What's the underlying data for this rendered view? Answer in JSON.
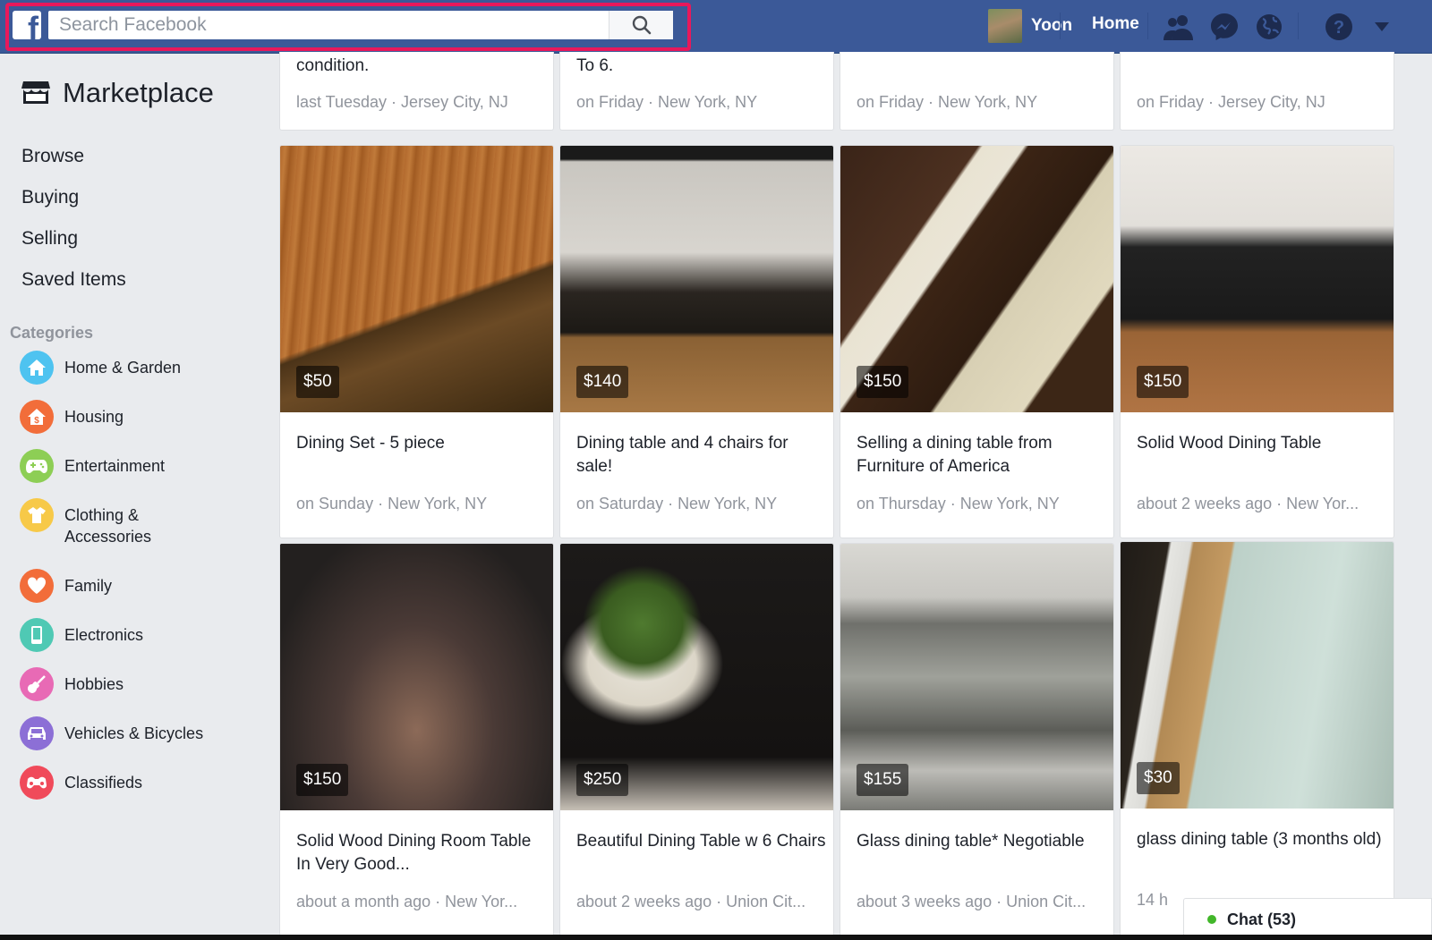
{
  "header": {
    "logo": "f",
    "search_placeholder": "Search Facebook",
    "user_name": "Yoon",
    "home_label": "Home",
    "icons": [
      "friends-icon",
      "messenger-icon",
      "globe-icon",
      "help-icon",
      "caret-down-icon"
    ]
  },
  "sidebar": {
    "title": "Marketplace",
    "nav": [
      "Browse",
      "Buying",
      "Selling",
      "Saved Items"
    ],
    "categories_heading": "Categories",
    "categories": [
      {
        "label": "Home & Garden",
        "icon": "house-icon",
        "color": "#4ec3f0"
      },
      {
        "label": "Housing",
        "icon": "house-dollar-icon",
        "color": "#f26d3a"
      },
      {
        "label": "Entertainment",
        "icon": "gamepad-icon",
        "color": "#8dce55"
      },
      {
        "label": "Clothing & Accessories",
        "icon": "shirt-icon",
        "color": "#f7c948"
      },
      {
        "label": "Family",
        "icon": "heart-icon",
        "color": "#f26d3a"
      },
      {
        "label": "Electronics",
        "icon": "phone-icon",
        "color": "#4fc9b4"
      },
      {
        "label": "Hobbies",
        "icon": "guitar-icon",
        "color": "#e86ab5"
      },
      {
        "label": "Vehicles & Bicycles",
        "icon": "car-icon",
        "color": "#8c6fd6"
      },
      {
        "label": "Classifieds",
        "icon": "classifieds-icon",
        "color": "#f04a5a"
      }
    ]
  },
  "top_row": [
    {
      "fragment": "condition.",
      "meta": "last Tuesday · Jersey City, NJ"
    },
    {
      "fragment": "To 6.",
      "meta": "on Friday · New York, NY"
    },
    {
      "fragment": "",
      "meta": "on Friday · New York, NY"
    },
    {
      "fragment": "",
      "meta": "on Friday · Jersey City, NJ"
    }
  ],
  "listings": [
    {
      "price": "$50",
      "title": "Dining Set - 5 piece",
      "meta": "on Sunday · New York, NY"
    },
    {
      "price": "$140",
      "title": "Dining table and 4 chairs for sale!",
      "meta": "on Saturday · New York, NY"
    },
    {
      "price": "$150",
      "title": "Selling a dining table from Furniture of America",
      "meta": "on Thursday · New York, NY"
    },
    {
      "price": "$150",
      "title": "Solid Wood Dining Table",
      "meta": "about 2 weeks ago · New Yor..."
    },
    {
      "price": "$150",
      "title": "Solid Wood Dining Room Table In Very Good...",
      "meta": "about a month ago · New Yor..."
    },
    {
      "price": "$250",
      "title": "Beautiful Dining Table w 6 Chairs",
      "meta": "about 2 weeks ago · Union Cit..."
    },
    {
      "price": "$155",
      "title": "Glass dining table* Negotiable",
      "meta": "about 3 weeks ago · Union Cit..."
    },
    {
      "price": "$30",
      "title": "glass dining table (3 months old)",
      "meta": "14 h"
    }
  ],
  "chat": {
    "label": "Chat (53)",
    "status_color": "#42b72a"
  }
}
